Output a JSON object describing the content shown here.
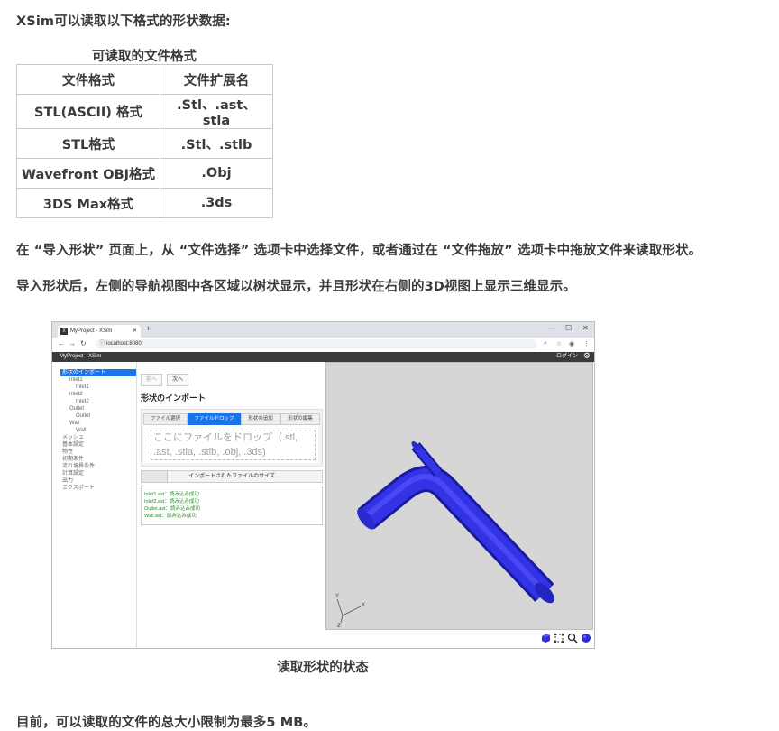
{
  "heading": "XSim可以读取以下格式的形状数据:",
  "table": {
    "caption": "可读取的文件格式",
    "headers": [
      "文件格式",
      "文件扩展名"
    ],
    "rows": [
      [
        "STL(ASCII) 格式",
        ".Stl、.ast、stla"
      ],
      [
        "STL格式",
        ".Stl、.stlb"
      ],
      [
        "Wavefront OBJ格式",
        ".Obj"
      ],
      [
        "3DS Max格式",
        ".3ds"
      ]
    ]
  },
  "para1": "在 “导入形状” 页面上，从 “文件选择” 选项卡中选择文件，或者通过在 “文件拖放” 选项卡中拖放文件来读取形状。",
  "para2": "导入形状后，左侧的导航视图中各区域以树状显示，并且形状在右侧的3D视图上显示三维显示。",
  "screenshot": {
    "browser": {
      "tab_title": "MyProject - XSim",
      "tab_icon": "X",
      "url": "localhost:8080"
    },
    "app": {
      "title": "MyProject - XSim",
      "login": "ログイン"
    },
    "tree": [
      {
        "label": "形状のインポート",
        "level": 0,
        "selected": true
      },
      {
        "label": "Inlet1",
        "level": 1
      },
      {
        "label": "Inlet1",
        "level": 2
      },
      {
        "label": "Inlet2",
        "level": 1
      },
      {
        "label": "Inlet2",
        "level": 2
      },
      {
        "label": "Outlet",
        "level": 1
      },
      {
        "label": "Outlet",
        "level": 2
      },
      {
        "label": "Wall",
        "level": 1
      },
      {
        "label": "Wall",
        "level": 2
      },
      {
        "label": "メッシュ",
        "level": 0
      },
      {
        "label": "基本設定",
        "level": 0
      },
      {
        "label": "物性",
        "level": 0
      },
      {
        "label": "初期条件",
        "level": 0
      },
      {
        "label": "流れ境界条件",
        "level": 0
      },
      {
        "label": "計算設定",
        "level": 0
      },
      {
        "label": "出力",
        "level": 0
      },
      {
        "label": "エクスポート",
        "level": 0
      }
    ],
    "panel": {
      "prev": "前へ",
      "next": "次へ",
      "title": "形状のインポート",
      "tabs": [
        "ファイル選択",
        "ファイルドロップ",
        "形状の追加",
        "形状の編集"
      ],
      "active_tab": 1,
      "drop_text_1": "ここにファイルをドロップ（.stl,",
      "drop_text_2": ".ast, .stla, .stlb, .obj, .3ds)",
      "size_label": "インポートされたファイルのサイズ",
      "log": [
        "Inlet1.ast：読み込み成功",
        "Inlet2.ast：読み込み成功",
        "Outlet.ast：読み込み成功",
        "Wall.ast：読み込み成功"
      ]
    },
    "view3d": {
      "axis_labels": [
        "Y",
        "X",
        "Z"
      ],
      "shape_color": "#2f2fe0",
      "background": "#d6d6d6"
    }
  },
  "caption_shot": "读取形状的状态",
  "para3": "目前，可以读取的文件的总大小限制为最多5 MB。"
}
